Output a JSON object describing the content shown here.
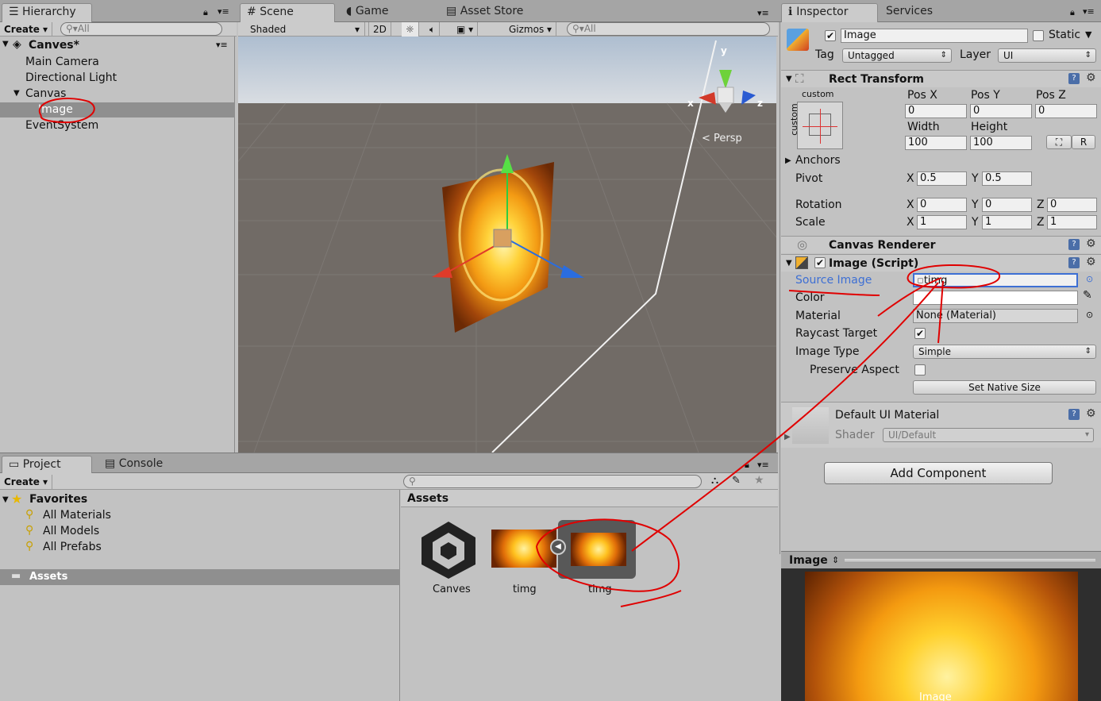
{
  "hierarchy": {
    "tab": "Hierarchy",
    "create": "Create",
    "search_placeholder": "All",
    "scene": "Canves*",
    "items": [
      "Main Camera",
      "Directional Light",
      "Canvas",
      "Image",
      "EventSystem"
    ]
  },
  "scene_view": {
    "tabs": [
      "Scene",
      "Game",
      "Asset Store"
    ],
    "shading": "Shaded",
    "mode_2d": "2D",
    "gizmos": "Gizmos",
    "search_placeholder": "All",
    "persp": "Persp",
    "axis_x": "x",
    "axis_y": "y",
    "axis_z": "z"
  },
  "inspector": {
    "tabs": [
      "Inspector",
      "Services"
    ],
    "object_name": "Image",
    "static_label": "Static",
    "tag_label": "Tag",
    "tag_value": "Untagged",
    "layer_label": "Layer",
    "layer_value": "UI",
    "rect_transform": {
      "title": "Rect Transform",
      "anchor_preset_top": "custom",
      "anchor_preset_side": "custom",
      "posx_label": "Pos X",
      "posy_label": "Pos Y",
      "posz_label": "Pos Z",
      "posx": "0",
      "posy": "0",
      "posz": "0",
      "width_label": "Width",
      "height_label": "Height",
      "width": "100",
      "height": "100",
      "r_button": "R",
      "anchors_label": "Anchors",
      "pivot_label": "Pivot",
      "pivot_x": "0.5",
      "pivot_y": "0.5",
      "rotation_label": "Rotation",
      "rot_x": "0",
      "rot_y": "0",
      "rot_z": "0",
      "scale_label": "Scale",
      "scale_x": "1",
      "scale_y": "1",
      "scale_z": "1",
      "x": "X",
      "y": "Y",
      "z": "Z"
    },
    "canvas_renderer": {
      "title": "Canvas Renderer"
    },
    "image_script": {
      "title": "Image (Script)",
      "source_image_label": "Source Image",
      "source_image_value": "timg",
      "color_label": "Color",
      "material_label": "Material",
      "material_value": "None (Material)",
      "raycast_label": "Raycast Target",
      "image_type_label": "Image Type",
      "image_type_value": "Simple",
      "preserve_label": "Preserve Aspect",
      "set_native_size": "Set Native Size"
    },
    "material": {
      "name": "Default UI Material",
      "shader_label": "Shader",
      "shader_value": "UI/Default"
    },
    "add_component": "Add Component",
    "preview_title": "Image",
    "preview_caption": "Image"
  },
  "project": {
    "tabs": [
      "Project",
      "Console"
    ],
    "create": "Create",
    "favorites": "Favorites",
    "favorite_items": [
      "All Materials",
      "All Models",
      "All Prefabs"
    ],
    "assets_folder": "Assets",
    "assets_header": "Assets",
    "assets": [
      "Canves",
      "timg",
      "timg"
    ]
  },
  "colors": {
    "accent_blue": "#3d6fd4",
    "annotation_red": "#e00000",
    "selection": "#8f8f8f"
  }
}
